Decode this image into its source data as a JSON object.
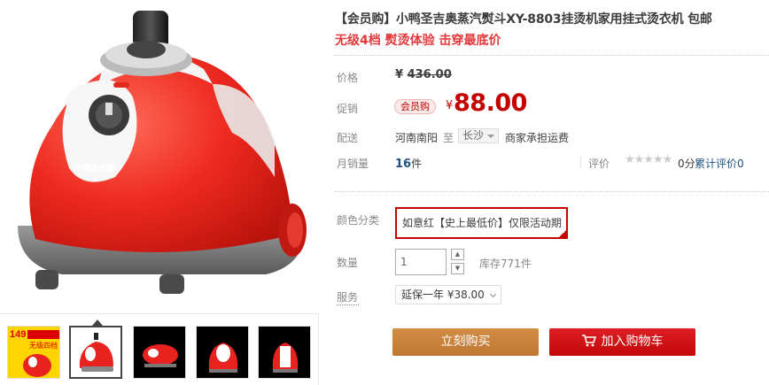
{
  "product": {
    "title": "【会员购】小鸭圣吉奥蒸汽熨斗XY-8803挂烫机家用挂式烫衣机 包邮",
    "subtitle": "无级4档 熨烫体验 击穿最底价",
    "brand_mark": "小鸭圣吉奥"
  },
  "price": {
    "label": "价格",
    "currency": "¥",
    "original": "436.00"
  },
  "promo": {
    "label": "促销",
    "tag": "会员购",
    "currency": "¥",
    "price": "88.00"
  },
  "shipping": {
    "label": "配送",
    "from": "河南南阳",
    "to_label": "至",
    "destination": "长沙",
    "fee_text": "商家承担运费"
  },
  "sales": {
    "label": "月销量",
    "count": "16",
    "unit": "件"
  },
  "rating": {
    "label": "评价",
    "stars": "★★★★★",
    "score": "0分",
    "link": "累计评价0"
  },
  "color": {
    "label": "颜色分类",
    "selected": "如意红【史上最低价】仅限活动期"
  },
  "quantity": {
    "label": "数量",
    "value": "1",
    "stock": "库存771件"
  },
  "service": {
    "label": "服务",
    "selected": "延保一年 ¥38.00"
  },
  "actions": {
    "buy_now": "立刻购买",
    "add_to_cart": "加入购物车"
  },
  "thumbnails": {
    "first_badge_top": "149",
    "first_badge_text": "无级四档"
  },
  "colors": {
    "accent_red": "#c40000",
    "buy_orange": "#c8813c",
    "cart_red": "#d2141a",
    "product_red": "#e8231f"
  }
}
